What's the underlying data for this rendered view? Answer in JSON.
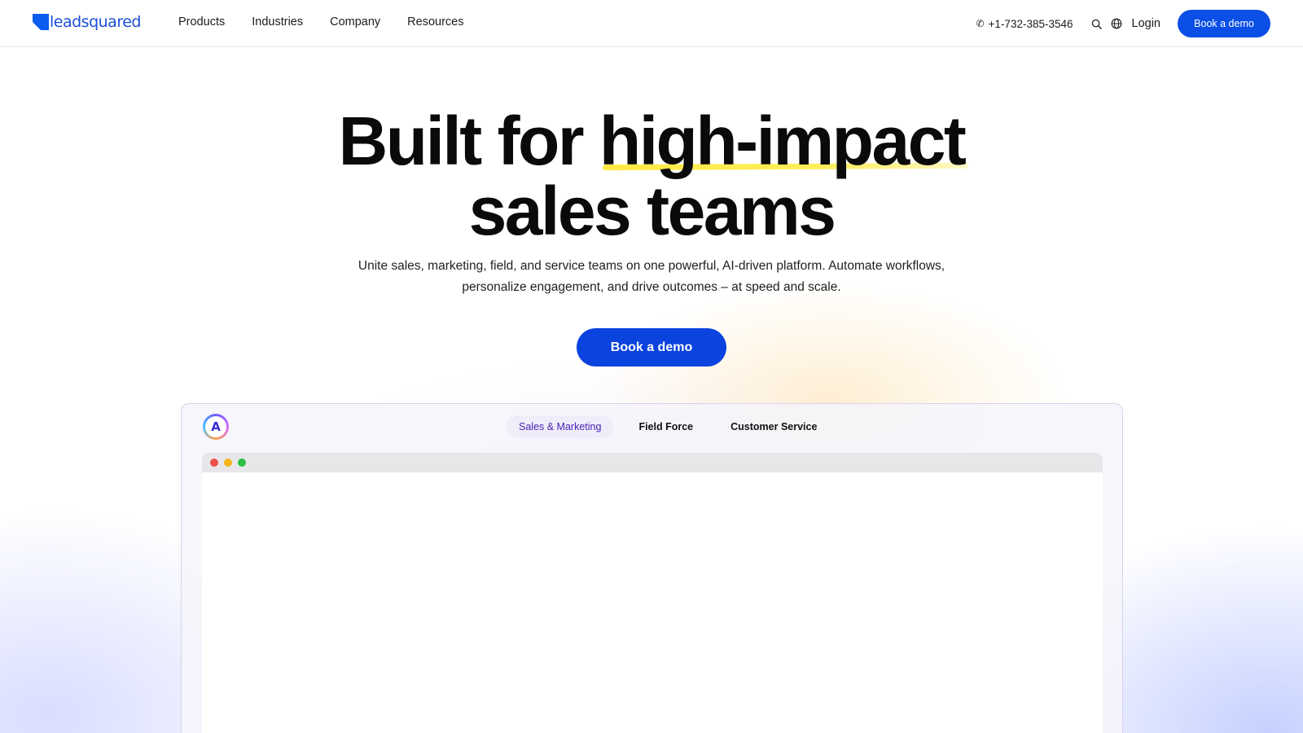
{
  "header": {
    "logo_text": "leadsquared",
    "nav": [
      {
        "label": "Products"
      },
      {
        "label": "Industries"
      },
      {
        "label": "Company"
      },
      {
        "label": "Resources"
      }
    ],
    "phone": "+1-732-385-3546",
    "login_label": "Login",
    "demo_label": "Book a demo"
  },
  "hero": {
    "title_part1": "Built for ",
    "title_highlight": "high-impact",
    "title_line2": "sales teams",
    "subtitle_line1": "Unite sales, marketing, field, and service teams on one powerful, AI-driven platform. Automate workflows,",
    "subtitle_line2": "personalize engagement, and drive outcomes – at speed and scale.",
    "cta_label": "Book a demo"
  },
  "product": {
    "tabs": [
      {
        "label": "Sales & Marketing",
        "active": true
      },
      {
        "label": "Field Force",
        "active": false
      },
      {
        "label": "Customer Service",
        "active": false
      }
    ],
    "window_dots": [
      "#ee4f4a",
      "#f5b51c",
      "#2bc044"
    ]
  },
  "colors": {
    "brand": "#0b5cf0",
    "cta": "#0b43df",
    "highlight": "#ffe730",
    "active_tab_text": "#4a1fb8"
  },
  "icons": [
    "phone-icon",
    "search-icon",
    "globe-icon",
    "ai-assistant-icon"
  ]
}
